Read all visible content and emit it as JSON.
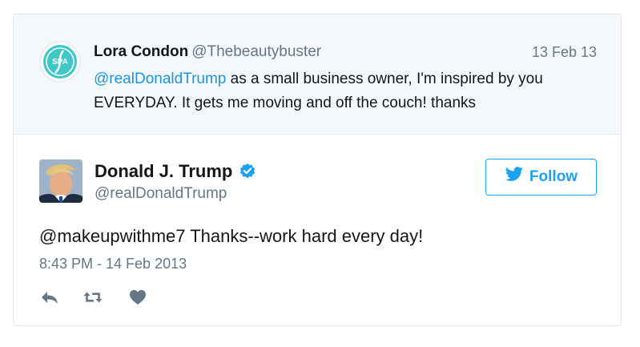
{
  "quoted_tweet": {
    "author_name": "Lora Condon",
    "author_handle": "@Thebeautybuster",
    "date": "13 Feb 13",
    "mention": "@realDonaldTrump",
    "text": " as a small business owner, I'm inspired by you EVERYDAY. It gets me moving and off the couch! thanks",
    "avatar_label": "SPA"
  },
  "tweet": {
    "author_name": "Donald J. Trump",
    "author_handle": "@realDonaldTrump",
    "text": "@makeupwithme7 Thanks--work hard every day!",
    "timestamp": "8:43 PM - 14 Feb 2013"
  },
  "follow_button": {
    "label": "Follow"
  },
  "icons": {
    "verified": "verified-badge-icon",
    "twitter_bird": "twitter-bird-icon",
    "reply": "reply-icon",
    "retweet": "retweet-icon",
    "like": "heart-icon"
  },
  "colors": {
    "accent": "#1da1f2",
    "mention": "#1b95e0",
    "muted": "#657786",
    "quoted_bg": "#f5f8fa",
    "action_icon": "#657786"
  }
}
